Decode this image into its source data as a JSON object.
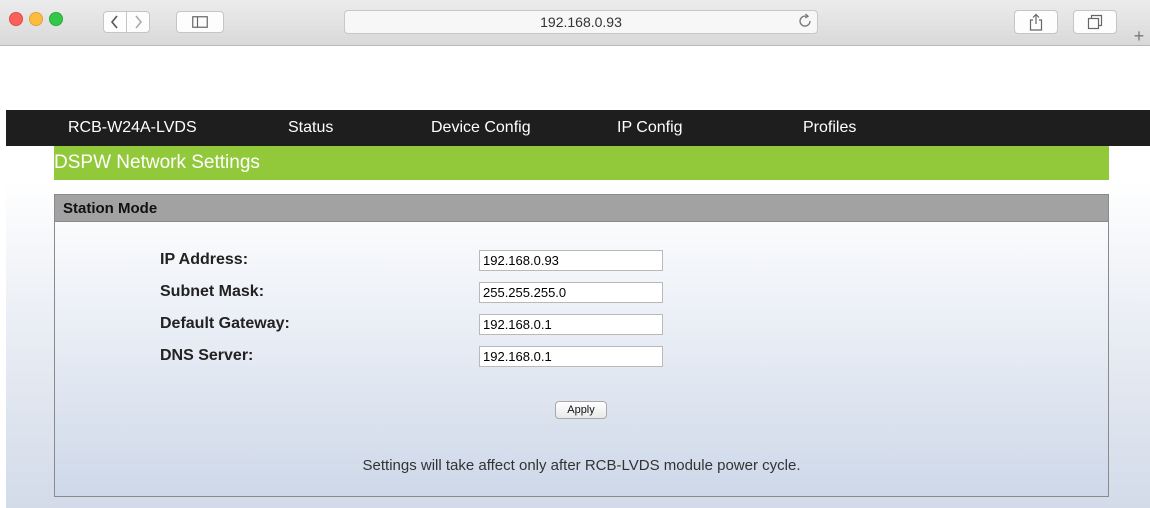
{
  "browser": {
    "url": "192.168.0.93",
    "new_tab": "+"
  },
  "nav": {
    "items": [
      {
        "label": "RCB-W24A-LVDS"
      },
      {
        "label": "Status"
      },
      {
        "label": "Device Config"
      },
      {
        "label": "IP Config"
      },
      {
        "label": "Profiles"
      }
    ]
  },
  "page": {
    "section_title": "DSPW Network Settings"
  },
  "panel": {
    "title": "Station Mode",
    "fields": [
      {
        "label": "IP Address:",
        "value": "192.168.0.93"
      },
      {
        "label": "Subnet Mask:",
        "value": "255.255.255.0"
      },
      {
        "label": "Default Gateway:",
        "value": "192.168.0.1"
      },
      {
        "label": "DNS Server:",
        "value": "192.168.0.1"
      }
    ],
    "apply_label": "Apply",
    "note": "Settings will take affect only after RCB-LVDS module power cycle."
  },
  "colors": {
    "nav_bg": "#1e1e1e",
    "accent_green": "#92c93a",
    "panel_header": "#a2a2a2"
  }
}
